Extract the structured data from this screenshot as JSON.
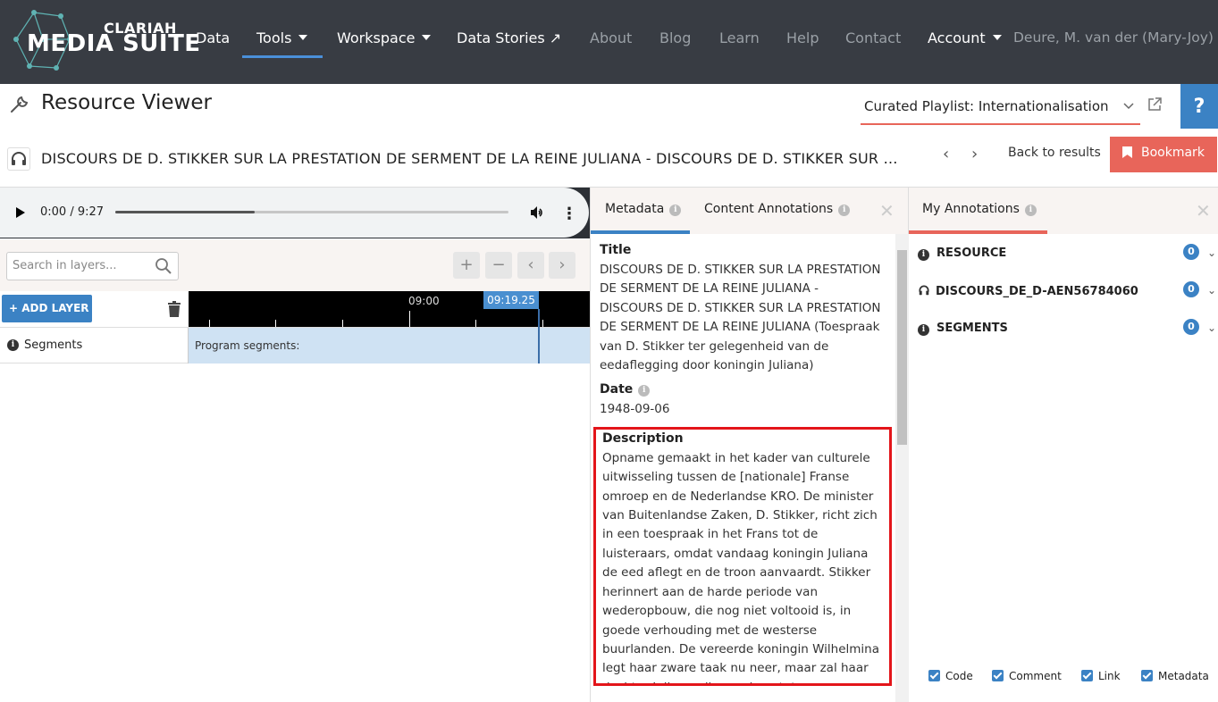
{
  "brand": {
    "line1": "CLARIAH",
    "line2": "MEDIA SUITE",
    "colors": {
      "nav_bg": "#383c43",
      "accent": "#3b82c4",
      "bookmark": "#e8655a",
      "highlight_box": "#e3151a"
    }
  },
  "nav": {
    "data": "Data",
    "tools": "Tools",
    "workspace": "Workspace",
    "data_stories": "Data Stories ↗",
    "about": "About",
    "blog": "Blog",
    "learn": "Learn",
    "help": "Help",
    "contact": "Contact",
    "account": "Account",
    "user": "Deure, M. van der (Mary-Joy)"
  },
  "viewer": {
    "title": "Resource Viewer",
    "playlist": "Curated Playlist: Internationalisation",
    "help": "?"
  },
  "resource": {
    "title": "DISCOURS DE D. STIKKER SUR LA PRESTATION DE SERMENT DE LA REINE JULIANA - DISCOURS DE D. STIKKER SUR LA PRESTATION DE SERMENT DE LA REINE JULIANA",
    "back": "Back to results",
    "bookmark": "Bookmark"
  },
  "player": {
    "time": "0:00 / 9:27",
    "progress": 0.355
  },
  "layers": {
    "search_placeholder": "Search in layers...",
    "add_layer": "+ ADD LAYER",
    "timeline_label": "09:00",
    "cursor_label": "09:19.25",
    "layer_name": "Segments",
    "layer_content": "Program segments:"
  },
  "metadata": {
    "tab_metadata": "Metadata",
    "tab_content": "Content Annotations",
    "title_label": "Title",
    "title_value": "DISCOURS DE D. STIKKER SUR LA PRESTATION DE SERMENT DE LA REINE JULIANA - DISCOURS DE D. STIKKER SUR LA PRESTATION DE SERMENT DE LA REINE JULIANA (Toespraak van D. Stikker ter gelegenheid van de eedaflegging door koningin Juliana)",
    "date_label": "Date",
    "date_value": "1948-09-06",
    "desc_label": "Description",
    "desc_value": "Opname gemaakt in het kader van culturele uitwisseling tussen de [nationale] Franse omroep en de Nederlandse KRO. De minister van Buitenlandse Zaken, D. Stikker, richt zich in een toespraak in het Frans tot de luisteraars, omdat vandaag koningin Juliana de eed aflegt en de troon aanvaardt. Stikker herinnert aan de harde periode van wederopbouw, die nog niet voltooid is, in goede verhouding met de westerse buurlanden. De vereerde koningin Wilhelmina legt haar zware taak nu neer, maar zal haar dochter Juliana, die vandaag tot"
  },
  "annotations": {
    "tab": "My Annotations",
    "rows": [
      {
        "label": "RESOURCE",
        "count": "0"
      },
      {
        "label": "DISCOURS_DE_D-AEN56784060",
        "count": "0"
      },
      {
        "label": "SEGMENTS",
        "count": "0"
      }
    ],
    "checks": {
      "code": "Code",
      "comment": "Comment",
      "link": "Link",
      "metadata": "Metadata"
    }
  }
}
